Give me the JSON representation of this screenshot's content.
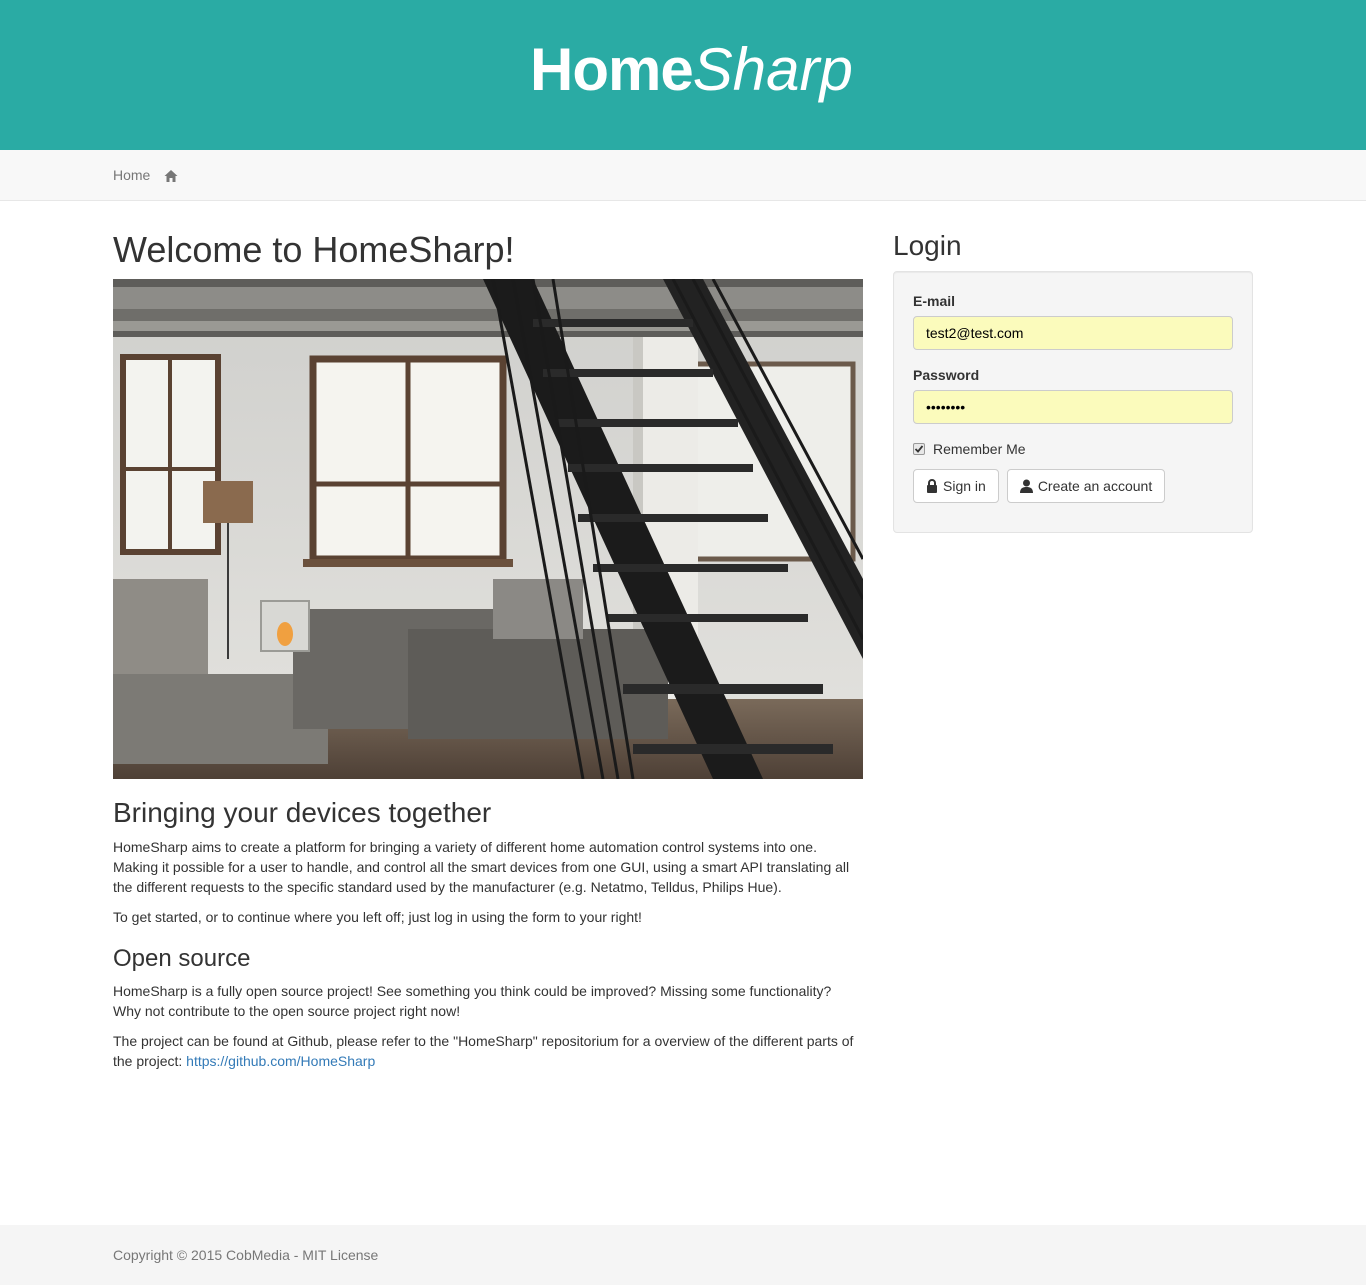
{
  "header": {
    "logo_bold": "Home",
    "logo_light": "Sharp",
    "background_color": "#2aaba4"
  },
  "breadcrumb": {
    "label": "Home",
    "icon": "home-icon"
  },
  "main": {
    "title": "Welcome to HomeSharp!",
    "section1_title": "Bringing your devices together",
    "section1_p1": "HomeSharp aims to create a platform for bringing a variety of different home automation control systems into one. Making it possible for a user to handle, and control all the smart devices from one GUI, using a smart API translating all the different requests to the specific standard used by the manufacturer (e.g. Netatmo, Telldus, Philips Hue).",
    "section1_p2": "To get started, or to continue where you left off; just log in using the form to your right!",
    "section2_title": "Open source",
    "section2_p1": "HomeSharp is a fully open source project! See something you think could be improved? Missing some functionality? Why not contribute to the open source project right now!",
    "section2_p2_prefix": "The project can be found at Github, please refer to the \"HomeSharp\" repositorium for a overview of the different parts of the project: ",
    "github_link": "https://github.com/HomeSharp"
  },
  "login": {
    "title": "Login",
    "email_label": "E-mail",
    "email_value": "test2@test.com",
    "password_label": "Password",
    "password_value": "••••••••",
    "remember_label": "Remember Me",
    "remember_checked": true,
    "signin_label": "Sign in",
    "signin_icon": "lock-icon",
    "create_label": "Create an account",
    "create_icon": "user-icon"
  },
  "footer": {
    "copyright": "Copyright © 2015 CobMedia - MIT License"
  }
}
